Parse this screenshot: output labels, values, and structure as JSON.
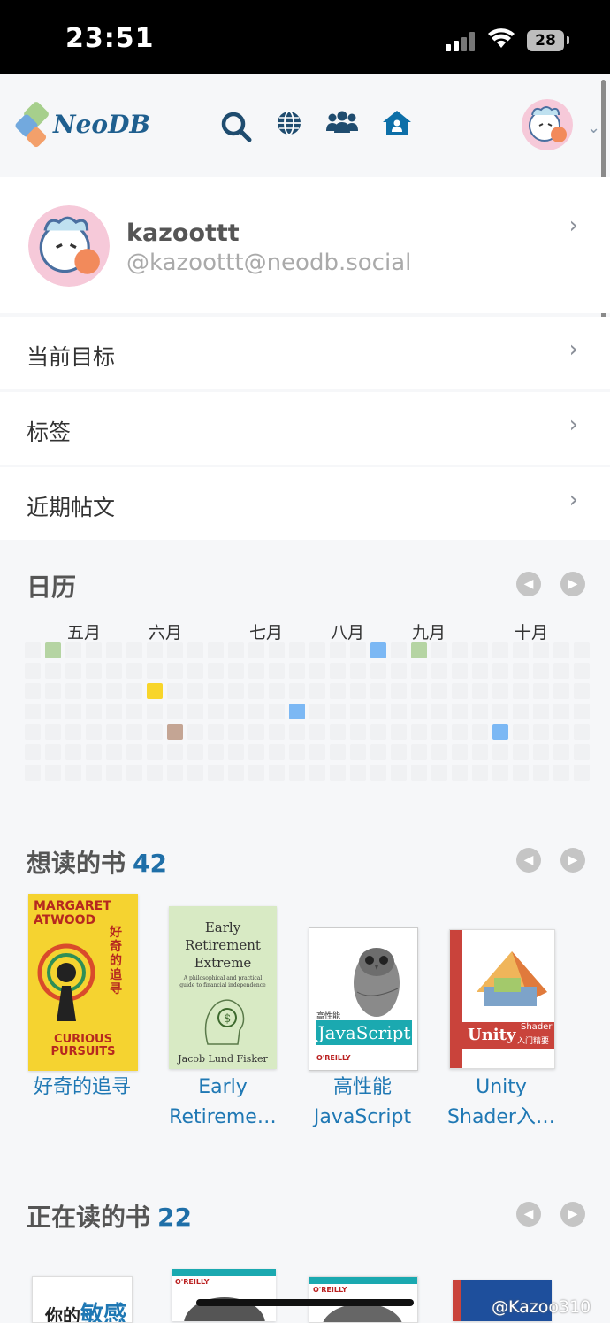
{
  "status_bar": {
    "time": "23:51",
    "battery": "28"
  },
  "app": {
    "logo_text": "NeoDB"
  },
  "nav": {
    "icons": [
      "search-icon",
      "globe-icon",
      "users-icon",
      "home-icon"
    ]
  },
  "profile": {
    "name": "kazoottt",
    "handle": "@kazoottt@neodb.social"
  },
  "menu": {
    "items": [
      {
        "label": "当前目标"
      },
      {
        "label": "标签"
      },
      {
        "label": "近期帖文"
      }
    ]
  },
  "calendar": {
    "title": "日历",
    "months": [
      "五月",
      "六月",
      "七月",
      "八月",
      "九月",
      "十月"
    ],
    "colors": {
      "green": "#b5d4a3",
      "yellow": "#f8d52a",
      "brown": "#c4a594",
      "blue": "#7cb8f4"
    }
  },
  "want_to_read": {
    "title": "想读的书",
    "count": "42",
    "books": [
      {
        "title": "好奇的追寻",
        "cover_lines": [
          "MARGARET",
          "ATWOOD",
          "好奇的追寻",
          "CURIOUS",
          "PURSUITS"
        ]
      },
      {
        "title": "Early\nRetireme…",
        "cover_lines": [
          "Early",
          "Retirement",
          "Extreme",
          "A philosophical and practical",
          "guide to financial independence",
          "Jacob Lund Fisker"
        ]
      },
      {
        "title": "高性能\nJavaScript",
        "cover_lines": [
          "高性能",
          "JavaScript",
          "O'REILLY"
        ]
      },
      {
        "title": "Unity\nShader入…",
        "cover_lines": [
          "Unity",
          "Shader",
          "入门精要"
        ]
      }
    ]
  },
  "reading": {
    "title": "正在读的书",
    "count": "22",
    "books": [
      {
        "cover_lines": [
          "你的",
          "敏感"
        ]
      },
      {
        "cover_lines": [
          "O'REILLY"
        ]
      },
      {
        "cover_lines": [
          "O'REILLY"
        ]
      },
      {
        "cover_lines": []
      }
    ]
  },
  "watermark": "@Kazoo310"
}
